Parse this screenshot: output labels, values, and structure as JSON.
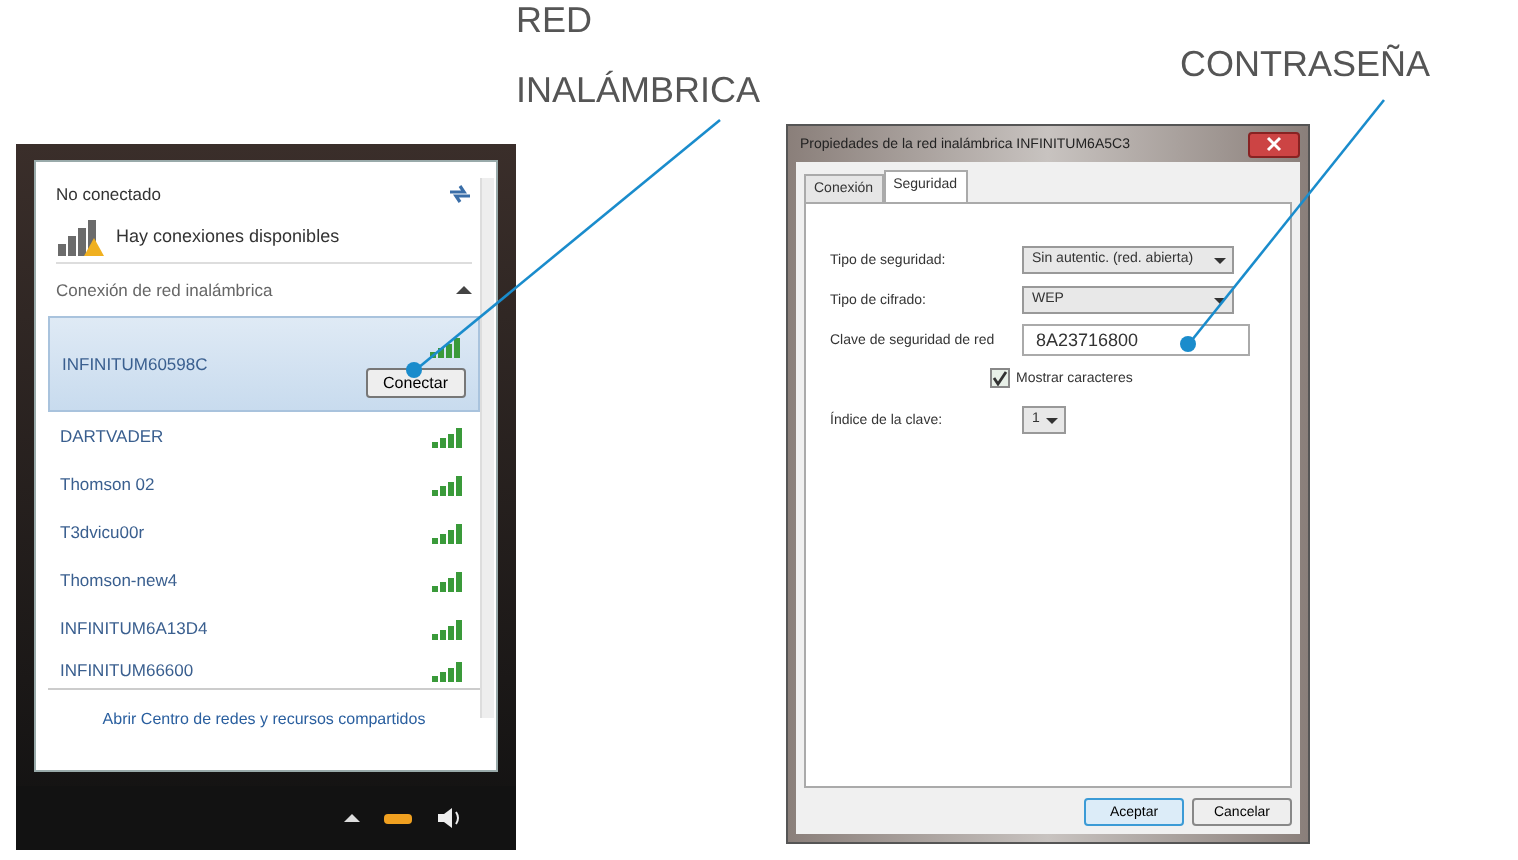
{
  "callouts": [
    {
      "lines": [
        "RED",
        "INALÁMBRICA"
      ]
    },
    {
      "lines": [
        "CONTRASEÑA"
      ]
    }
  ],
  "wifi_popup": {
    "status": "No conectado",
    "availability": "Hay conexiones disponibles",
    "section": "Conexión de red inalámbrica",
    "networks": [
      {
        "name": "INFINITUM60598C",
        "selected": true,
        "action": "Conectar"
      },
      {
        "name": "DARTVADER",
        "selected": false
      },
      {
        "name": "Thomson 02",
        "selected": false
      },
      {
        "name": "T3dvicu00r",
        "selected": false
      },
      {
        "name": "Thomson-new4",
        "selected": false
      },
      {
        "name": "INFINITUM6A13D4",
        "selected": false
      },
      {
        "name": "INFINITUM66600",
        "selected": false
      }
    ],
    "link": "Abrir Centro de redes y recursos compartidos"
  },
  "dialog": {
    "title": "Propiedades de la red inalámbrica INFINITUM6A5C3",
    "tabs": [
      {
        "label": "Conexión",
        "selected": false
      },
      {
        "label": "Seguridad",
        "selected": true
      }
    ],
    "security_type": {
      "label": "Tipo de seguridad:",
      "value": "Sin autentic. (red. abierta)"
    },
    "encryption": {
      "label": "Tipo de cifrado:",
      "value": "WEP"
    },
    "key": {
      "label": "Clave de seguridad de red",
      "value": "8A23716800"
    },
    "show_characters": {
      "label": "Mostrar caracteres",
      "checked": true
    },
    "key_index": {
      "label": "Índice de la clave:",
      "value": "1"
    },
    "buttons": [
      "Aceptar",
      "Cancelar"
    ]
  }
}
